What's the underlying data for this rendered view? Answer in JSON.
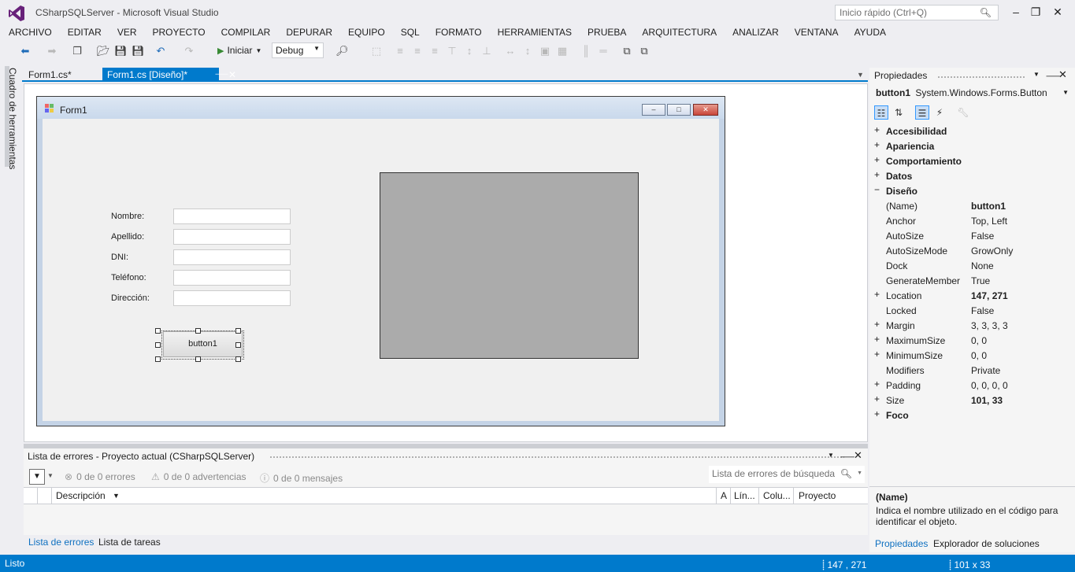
{
  "app": {
    "title": "CSharpSQLServer - Microsoft Visual Studio",
    "quicklaunch_placeholder": "Inicio rápido (Ctrl+Q)"
  },
  "menu": [
    "ARCHIVO",
    "EDITAR",
    "VER",
    "PROYECTO",
    "COMPILAR",
    "DEPURAR",
    "EQUIPO",
    "SQL",
    "FORMATO",
    "HERRAMIENTAS",
    "PRUEBA",
    "ARQUITECTURA",
    "ANALIZAR",
    "VENTANA",
    "AYUDA"
  ],
  "toolbar": {
    "start_label": "Iniciar",
    "config_value": "Debug"
  },
  "toolbox": {
    "label": "Cuadro de herramientas"
  },
  "doc_tabs": [
    {
      "label": "Form1.cs*"
    },
    {
      "label": "Form1.cs [Diseño]*"
    }
  ],
  "designer": {
    "form_title": "Form1",
    "labels": [
      "Nombre:",
      "Apellido:",
      "DNI:",
      "Teléfono:",
      "Dirección:"
    ],
    "button_label": "button1"
  },
  "error_list": {
    "title": "Lista de errores - Proyecto actual (CSharpSQLServer)",
    "errors": "0 de 0 errores",
    "warnings": "0 de 0 advertencias",
    "messages": "0 de 0 mensajes",
    "search_placeholder": "Lista de errores de búsqueda",
    "columns": [
      "Descripción",
      "A",
      "Lín...",
      "Colu...",
      "Proyecto"
    ]
  },
  "bottom_tabs": [
    "Lista de errores",
    "Lista de tareas"
  ],
  "properties": {
    "title": "Propiedades",
    "object_name": "button1",
    "object_type": "System.Windows.Forms.Button",
    "rows": [
      {
        "name": "Accesibilidad",
        "value": "",
        "category": true,
        "expander": "+"
      },
      {
        "name": "Apariencia",
        "value": "",
        "category": true,
        "expander": "+"
      },
      {
        "name": "Comportamiento",
        "value": "",
        "category": true,
        "expander": "+"
      },
      {
        "name": "Datos",
        "value": "",
        "category": true,
        "expander": "+"
      },
      {
        "name": "Diseño",
        "value": "",
        "category": true,
        "expander": "−"
      },
      {
        "name": "(Name)",
        "value": "button1",
        "bold": true,
        "expander": ""
      },
      {
        "name": "Anchor",
        "value": "Top, Left",
        "expander": ""
      },
      {
        "name": "AutoSize",
        "value": "False",
        "expander": ""
      },
      {
        "name": "AutoSizeMode",
        "value": "GrowOnly",
        "expander": ""
      },
      {
        "name": "Dock",
        "value": "None",
        "expander": ""
      },
      {
        "name": "GenerateMember",
        "value": "True",
        "expander": ""
      },
      {
        "name": "Location",
        "value": "147, 271",
        "bold": true,
        "expander": "+"
      },
      {
        "name": "Locked",
        "value": "False",
        "expander": ""
      },
      {
        "name": "Margin",
        "value": "3, 3, 3, 3",
        "expander": "+"
      },
      {
        "name": "MaximumSize",
        "value": "0, 0",
        "expander": "+"
      },
      {
        "name": "MinimumSize",
        "value": "0, 0",
        "expander": "+"
      },
      {
        "name": "Modifiers",
        "value": "Private",
        "expander": ""
      },
      {
        "name": "Padding",
        "value": "0, 0, 0, 0",
        "expander": "+"
      },
      {
        "name": "Size",
        "value": "101, 33",
        "bold": true,
        "expander": "+"
      },
      {
        "name": "Foco",
        "value": "",
        "category": true,
        "expander": "+"
      }
    ],
    "desc_name": "(Name)",
    "desc_text": "Indica el nombre utilizado en el código para identificar el objeto.",
    "tabs": [
      "Propiedades",
      "Explorador de soluciones"
    ]
  },
  "status": {
    "text": "Listo",
    "position": "147 , 271",
    "size": "101 x 33"
  },
  "colors": {
    "accent": "#007acc",
    "chrome": "#eeeef2",
    "picture_box": "#ababab"
  }
}
